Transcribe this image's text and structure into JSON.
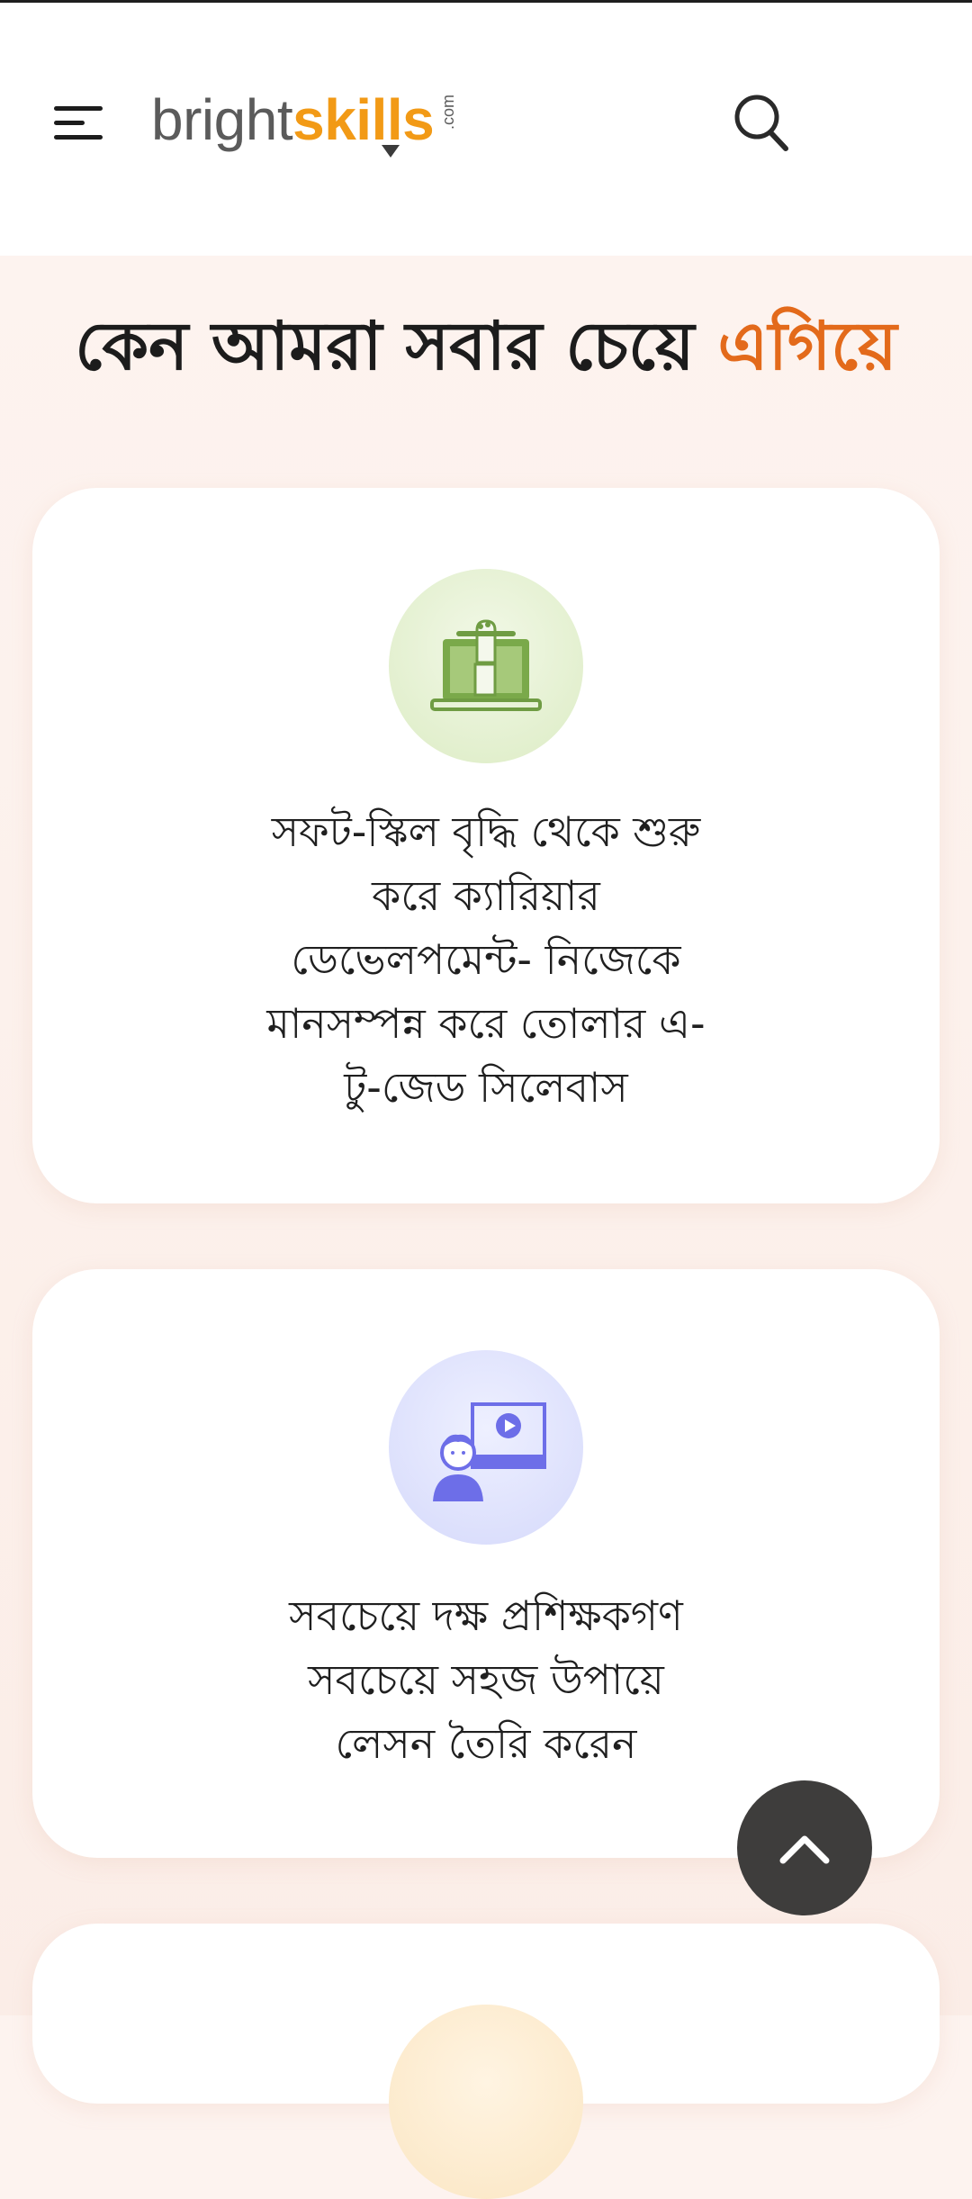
{
  "header": {
    "logo_part1": "bright",
    "logo_part2": "skills",
    "logo_suffix": ".com",
    "menu_icon": "hamburger-menu-icon",
    "search_icon": "search-icon"
  },
  "section": {
    "headline_part1": "কেন আমরা সবার চেয়ে",
    "headline_accent": "এগিয়ে",
    "accent_color": "#e36a1b"
  },
  "features": [
    {
      "icon": "laptop-fist-pencil-icon",
      "lines": [
        "সফট-স্কিল বৃদ্ধি থেকে শুরু",
        "করে ক্যারিয়ার",
        "ডেভেলপমেন্ট- নিজেকে",
        "মানসম্পন্ন করে তোলার এ-",
        "টু-জেড সিলেবাস"
      ]
    },
    {
      "icon": "instructor-video-screen-icon",
      "lines": [
        "সবচেয়ে দক্ষ প্রশিক্ষকগণ",
        "সবচেয়ে সহজ উপায়ে",
        "লেসন তৈরি করেন"
      ]
    },
    {
      "icon": "partial-feature-icon",
      "lines": []
    }
  ],
  "scroll_top": {
    "icon": "chevron-up-icon"
  },
  "colors": {
    "brand_orange": "#f29a16",
    "brand_grey": "#5b5b5b",
    "background": "#fdf3ef"
  }
}
